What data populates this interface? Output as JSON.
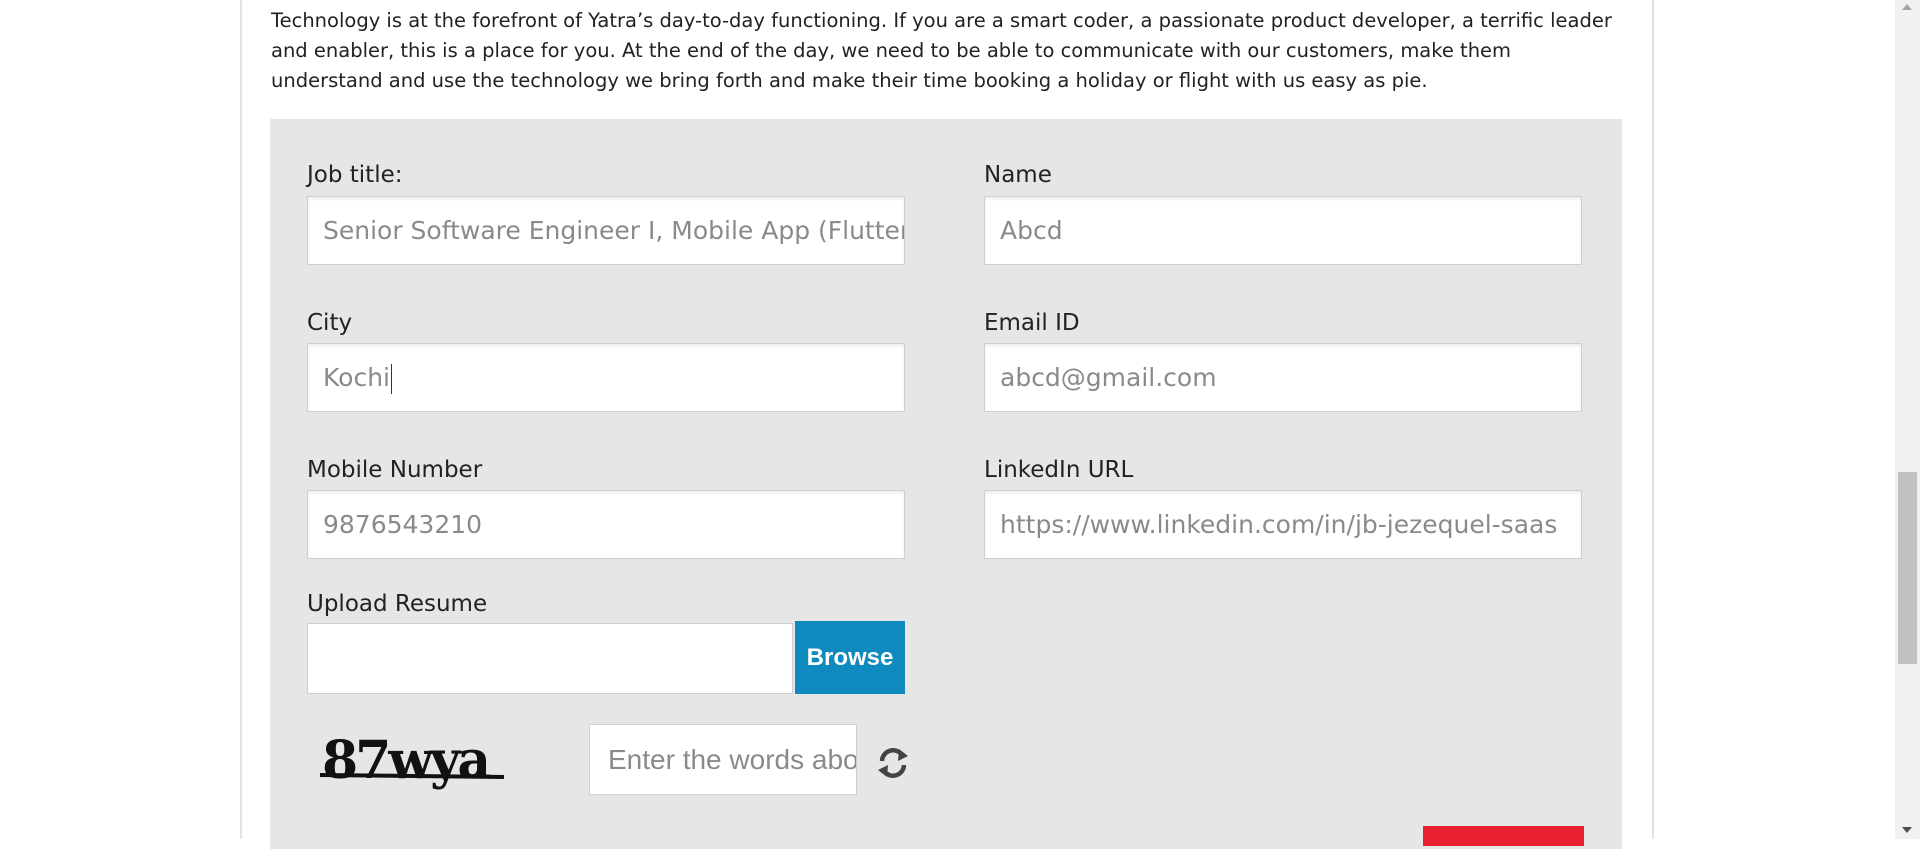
{
  "intro_text": "Technology is at the forefront of Yatra’s day-to-day functioning. If you are a smart coder, a passionate product developer, a terrific leader and enabler, this is a place for you. At the end of the day, we need to be able to communicate with our customers, make them understand and use the technology we bring forth and make their time booking a holiday or flight with us easy as pie.",
  "form": {
    "job_title": {
      "label": "Job title:",
      "value": "Senior Software Engineer I, Mobile App (Flutter)"
    },
    "name": {
      "label": "Name",
      "value": "Abcd"
    },
    "city": {
      "label": "City",
      "value": "Kochi"
    },
    "email": {
      "label": "Email ID",
      "value": "abcd@gmail.com"
    },
    "mobile": {
      "label": "Mobile Number",
      "value": "9876543210"
    },
    "linkedin": {
      "label": "LinkedIn URL",
      "value": "https://www.linkedin.com/in/jb-jezequel-saas"
    },
    "resume": {
      "label": "Upload Resume",
      "value": "",
      "browse_label": "Browse"
    },
    "captcha": {
      "text": "87wya",
      "placeholder": "Enter the words above"
    }
  },
  "colors": {
    "browse": "#0f8abf",
    "submit": "#e8202f",
    "form_bg": "#e6e6e6"
  }
}
